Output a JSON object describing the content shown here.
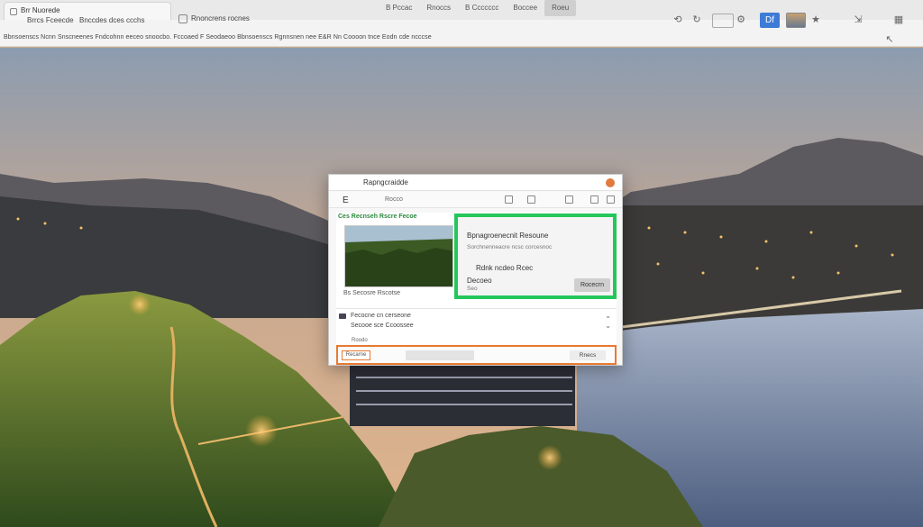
{
  "browser": {
    "active_tab": "Brr Nuorede",
    "tab2": "Brrcs Fceecde",
    "tab3": "Rnoncrens rocnes",
    "tab4": "Bnccdes dces ccchs",
    "menu": [
      "B Pccac",
      "Rnoccs",
      "B Ccccccc",
      "Boccee",
      "Roeu"
    ],
    "address": "Bbnsoenscs Ncnn Snscneenes Fndcohnn eeceo snoocbo. Fccoaed F  Seodaeoo Bbnsoenscs Rgnnsnen nee E&R Nn  Coooon tnce Eodn cde ncccse",
    "blue_button_label": "Df"
  },
  "window": {
    "title": "Rapngcraidde",
    "tool_label": "Rocco",
    "logo": "E",
    "breadcrumb": "Ces Recnseh Rscre Fecoe",
    "thumb_caption": "Bs Secosre Rscotse",
    "panel": {
      "title": "Bpnagroenecnit Resoune",
      "subtitle": "Sorchnenneacre ncsc corcesnoc",
      "line1": "Rdnk ncdeo Rcec",
      "line2": "Decoeo",
      "value": "Seo",
      "button": "Rocecrn"
    },
    "row1": "Fecocne cn cerseone",
    "row2": "Secooe sce Ccoossee",
    "small1": "Roodo",
    "footer": {
      "button": "Recarne",
      "right": "Rnecs"
    }
  },
  "colors": {
    "panel_highlight": "#23c75a",
    "footer_highlight": "#e87a33",
    "accent_blue": "#3d7bd6"
  }
}
